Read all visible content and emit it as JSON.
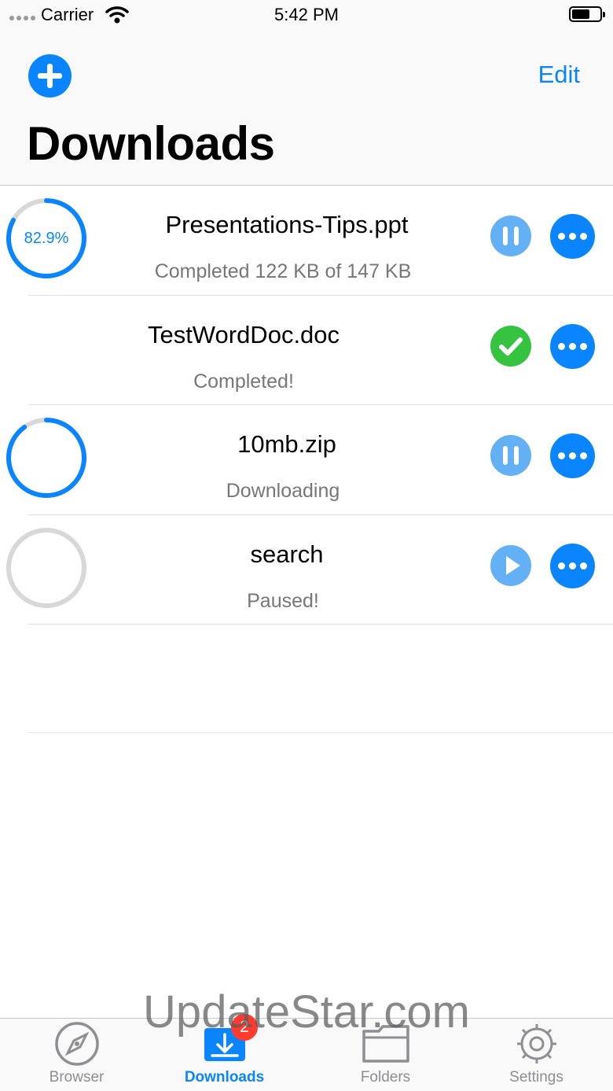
{
  "status_bar": {
    "carrier": "Carrier",
    "time": "5:42 PM",
    "wifi_icon": "wifi-icon",
    "battery_icon": "battery-icon"
  },
  "nav": {
    "add_icon": "plus-circle-icon",
    "edit_label": "Edit",
    "title": "Downloads"
  },
  "colors": {
    "accent": "#0a84ff",
    "light_accent": "#63b0f5",
    "success": "#36c33f",
    "badge": "#ff3b30",
    "ring_track": "#d8d8d8"
  },
  "downloads": [
    {
      "name": "Presentations-Tips.ppt",
      "status": "Completed 122 KB of 147 KB",
      "progress_label": "82.9%",
      "progress": 0.829,
      "state": "downloading",
      "action_icon": "pause-icon",
      "more_icon": "more-icon"
    },
    {
      "name": "TestWordDoc.doc",
      "status": "Completed!",
      "progress": 1.0,
      "state": "completed",
      "action_icon": "checkmark-icon",
      "more_icon": "more-icon"
    },
    {
      "name": "10mb.zip",
      "status": "Downloading",
      "progress": 0.9,
      "state": "downloading",
      "action_icon": "pause-icon",
      "more_icon": "more-icon"
    },
    {
      "name": "search",
      "status": "Paused!",
      "progress": 0.0,
      "state": "paused",
      "action_icon": "play-icon",
      "more_icon": "more-icon"
    }
  ],
  "tab_bar": {
    "tabs": [
      {
        "label": "Browser",
        "icon": "compass-icon",
        "active": false
      },
      {
        "label": "Downloads",
        "icon": "download-tray-icon",
        "active": true,
        "badge": "2"
      },
      {
        "label": "Folders",
        "icon": "folder-icon",
        "active": false
      },
      {
        "label": "Settings",
        "icon": "gear-icon",
        "active": false
      }
    ]
  },
  "watermark": "UpdateStar.com"
}
